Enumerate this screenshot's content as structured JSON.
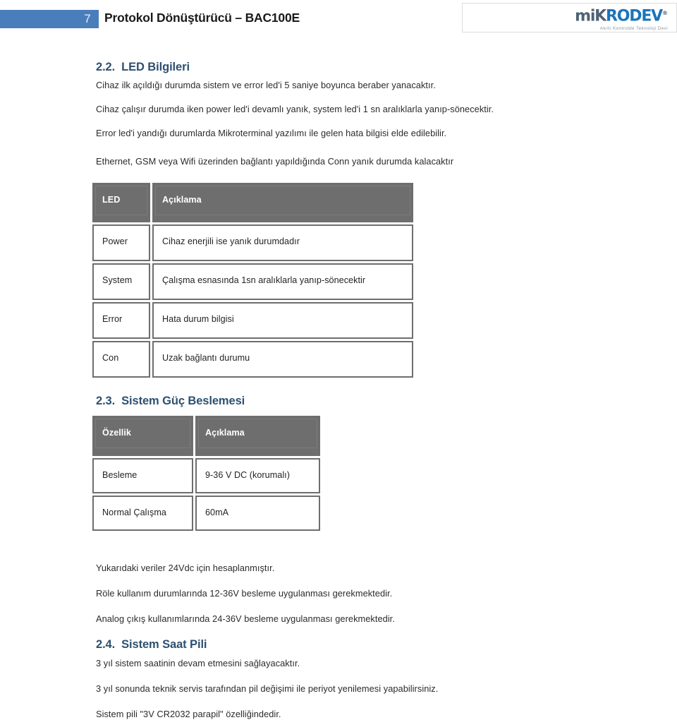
{
  "header": {
    "page_number": "7",
    "title": "Protokol Dönüştürücü – BAC100E",
    "logo": {
      "name_part1": "miK",
      "name_part2": "RODEV",
      "registered": "®",
      "tagline": "Akıllı Kontrolde Teknoloji Devi"
    }
  },
  "sections": {
    "led": {
      "number": "2.2.",
      "title": "LED Bilgileri",
      "paragraphs": [
        "Cihaz ilk açıldığı durumda sistem ve error led'i 5 saniye boyunca beraber yanacaktır.",
        "Cihaz çalışır durumda iken power led'i devamlı yanık, system led'i 1 sn aralıklarla yanıp-sönecektir.",
        "Error led'i yandığı durumlarda Mikroterminal yazılımı ile gelen hata bilgisi elde edilebilir.",
        "Ethernet, GSM veya Wifi üzerinden bağlantı yapıldığında Conn yanık durumda kalacaktır"
      ],
      "table": {
        "headers": [
          "LED",
          "Açıklama"
        ],
        "rows": [
          [
            "Power",
            "Cihaz enerjili ise yanık durumdadır"
          ],
          [
            "System",
            "Çalışma esnasında 1sn aralıklarla yanıp-sönecektir"
          ],
          [
            "Error",
            "Hata durum bilgisi"
          ],
          [
            "Con",
            "Uzak bağlantı durumu"
          ]
        ]
      }
    },
    "power": {
      "number": "2.3.",
      "title": "Sistem Güç Beslemesi",
      "table": {
        "headers": [
          "Özellik",
          "Açıklama"
        ],
        "rows": [
          [
            "Besleme",
            "9-36 V DC (korumalı)"
          ],
          [
            "Normal Çalışma",
            "60mA"
          ]
        ]
      },
      "notes": [
        "Yukarıdaki veriler 24Vdc için hesaplanmıştır.",
        "Röle kullanım durumlarında 12-36V besleme uygulanması gerekmektedir.",
        "Analog çıkış kullanımlarında 24-36V besleme uygulanması gerekmektedir."
      ]
    },
    "battery": {
      "number": "2.4.",
      "title": "Sistem Saat Pili",
      "paragraphs": [
        "3 yıl sistem saatinin devam etmesini sağlayacaktır.",
        "3 yıl sonunda teknik servis tarafından pil değişimi ile periyot yenilemesi yapabilirsiniz.",
        "Sistem pili \"3V CR2032 parapil\" özelliğindedir."
      ]
    }
  },
  "colors": {
    "page_bar": "#4a7ebb",
    "heading": "#2e5070",
    "table_header_bg": "#6e6e6e",
    "logo_dark": "#4e6274",
    "logo_blue": "#1b75bb"
  }
}
